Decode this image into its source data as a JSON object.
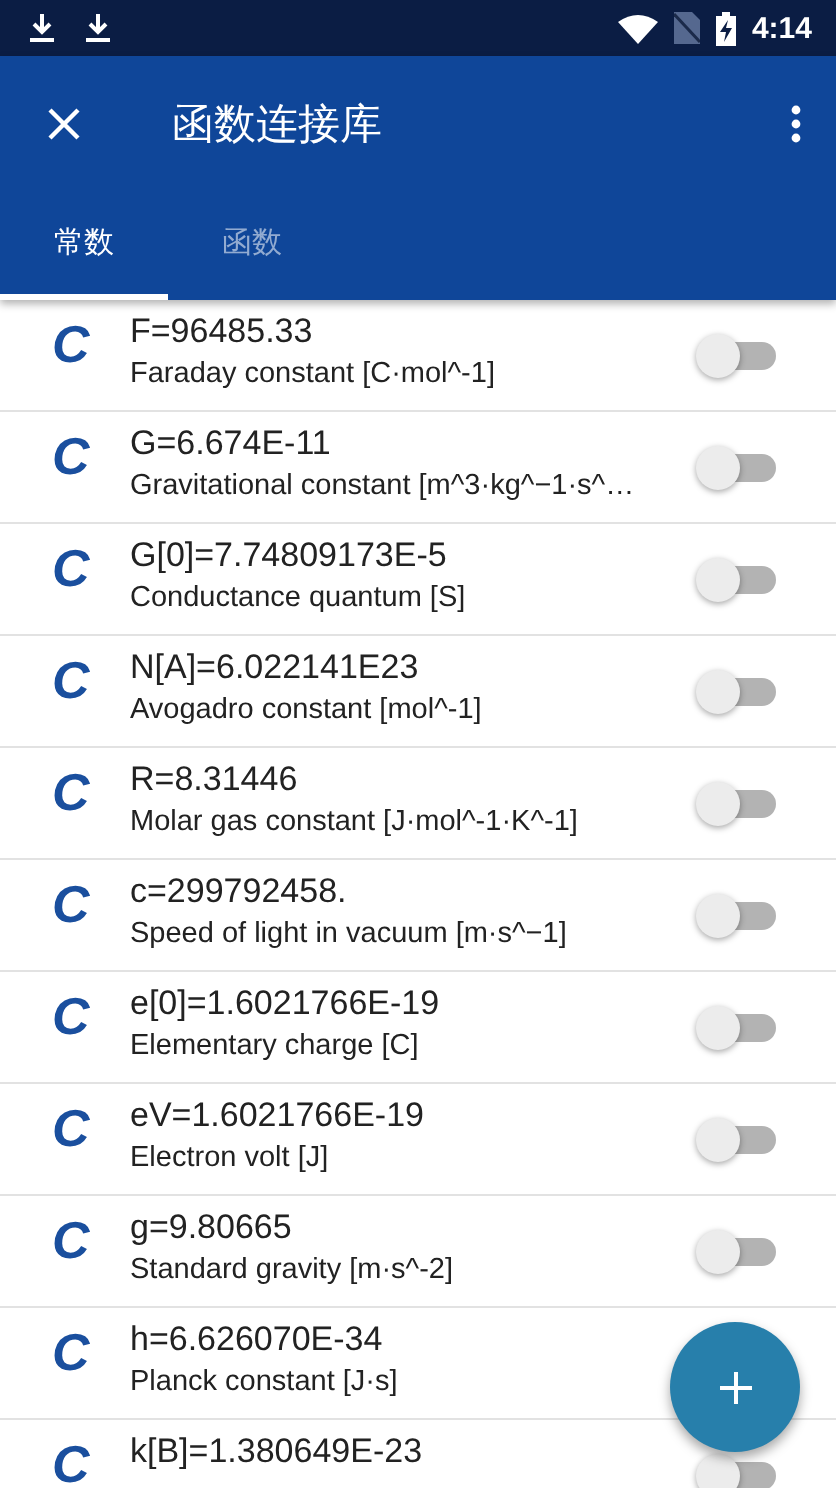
{
  "status_bar": {
    "time": "4:14"
  },
  "toolbar": {
    "title": "函数连接库"
  },
  "tabs": [
    {
      "label": "常数",
      "selected": true
    },
    {
      "label": "函数",
      "selected": false
    }
  ],
  "constants": [
    {
      "icon": "C",
      "value": "F=96485.33",
      "description": "Faraday constant [C·mol^-1]",
      "on": false
    },
    {
      "icon": "C",
      "value": "G=6.674E-11",
      "description": "Gravitational constant [m^3·kg^−1·s^…",
      "on": false
    },
    {
      "icon": "C",
      "value": "G[0]=7.74809173E-5",
      "description": "Conductance quantum [S]",
      "on": false
    },
    {
      "icon": "C",
      "value": "N[A]=6.022141E23",
      "description": "Avogadro constant [mol^-1]",
      "on": false
    },
    {
      "icon": "C",
      "value": "R=8.31446",
      "description": "Molar gas constant [J·mol^-1·K^-1]",
      "on": false
    },
    {
      "icon": "C",
      "value": "c=299792458.",
      "description": "Speed of light in vacuum  [m·s^−1]",
      "on": false
    },
    {
      "icon": "C",
      "value": "e[0]=1.6021766E-19",
      "description": "Elementary charge [C]",
      "on": false
    },
    {
      "icon": "C",
      "value": "eV=1.6021766E-19",
      "description": "Electron volt [J]",
      "on": false
    },
    {
      "icon": "C",
      "value": "g=9.80665",
      "description": "Standard gravity [m·s^-2]",
      "on": false
    },
    {
      "icon": "C",
      "value": "h=6.626070E-34",
      "description": "Planck constant [J·s]"
    },
    {
      "icon": "C",
      "value": "k[B]=1.380649E-23",
      "on": false
    }
  ]
}
